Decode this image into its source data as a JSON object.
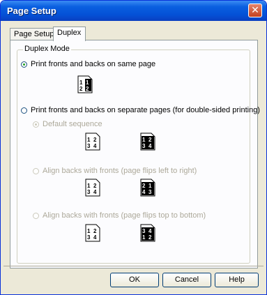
{
  "window": {
    "title": "Page Setup"
  },
  "tabs": [
    {
      "label": "Page Setup"
    },
    {
      "label": "Duplex"
    }
  ],
  "group": {
    "label": "Duplex Mode"
  },
  "options": {
    "same_page": "Print fronts and backs on same page",
    "separate_pages": "Print fronts and backs on separate pages (for double-sided printing)",
    "default_sequence": "Default sequence",
    "align_left_right": "Align backs with fronts (page flips left to right)",
    "align_top_bottom": "Align backs with fronts (page flips top to bottom)"
  },
  "page_icons": {
    "same_page": [
      "1",
      "1",
      "2",
      "2"
    ],
    "default_front": [
      "1",
      "2",
      "3",
      "4"
    ],
    "default_back": [
      "1",
      "2",
      "3",
      "4"
    ],
    "lr_front": [
      "1",
      "2",
      "3",
      "4"
    ],
    "lr_back": [
      "2",
      "1",
      "4",
      "3"
    ],
    "tb_front": [
      "1",
      "2",
      "3",
      "4"
    ],
    "tb_back": [
      "3",
      "4",
      "1",
      "2"
    ]
  },
  "buttons": {
    "ok": "OK",
    "cancel": "Cancel",
    "help": "Help"
  }
}
